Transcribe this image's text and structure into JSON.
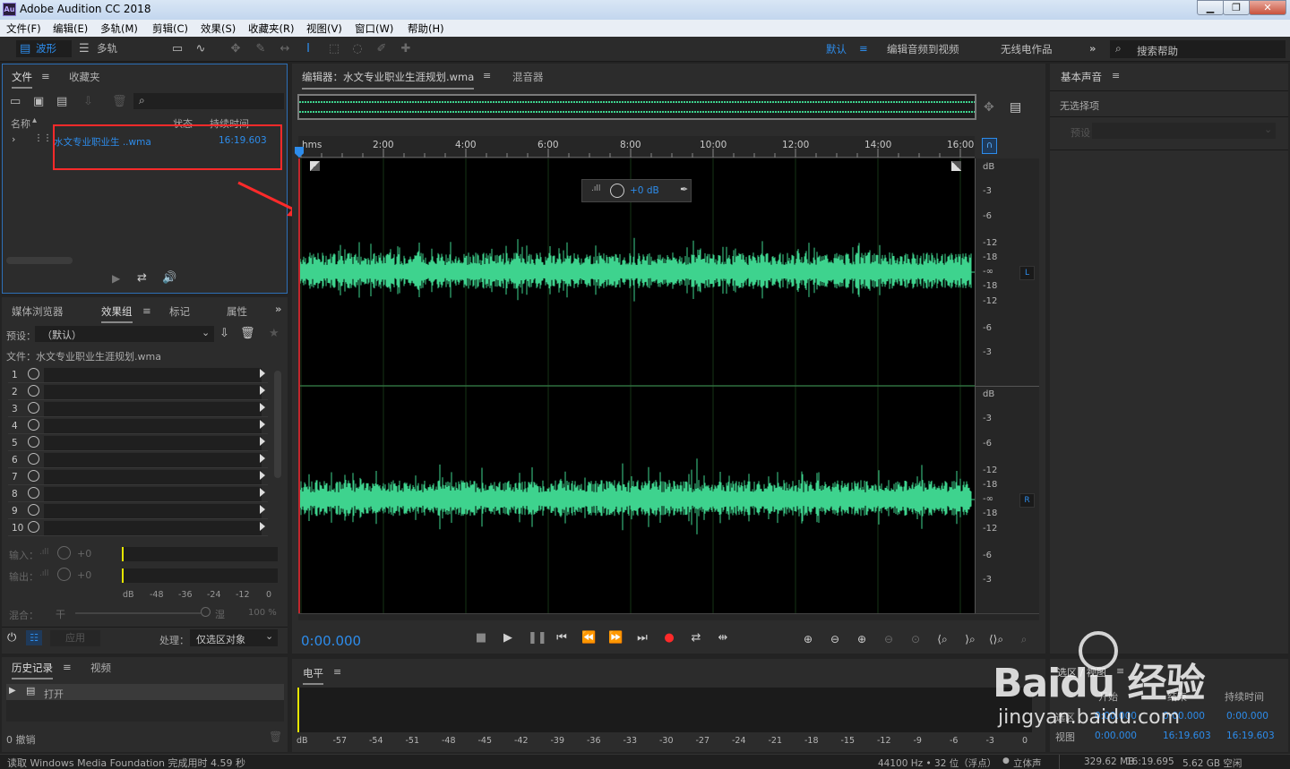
{
  "app": {
    "title": "Adobe Audition CC 2018",
    "logo": "Au"
  },
  "menu": [
    "文件(F)",
    "编辑(E)",
    "多轨(M)",
    "剪辑(C)",
    "效果(S)",
    "收藏夹(R)",
    "视图(V)",
    "窗口(W)",
    "帮助(H)"
  ],
  "toolbar": {
    "waveform": "波形",
    "multitrack": "多轨",
    "workspaces": [
      "默认",
      "编辑音频到视频",
      "无线电作品"
    ],
    "more": "»",
    "search_placeholder": "搜索帮助"
  },
  "files_panel": {
    "tabs": [
      "文件",
      "收藏夹"
    ],
    "columns": {
      "name": "名称",
      "status": "状态",
      "duration": "持续时间"
    },
    "file": {
      "name": "水文专业职业生 ..wma",
      "duration": "16:19.603"
    }
  },
  "effects_panel": {
    "tabs": [
      "媒体浏览器",
      "效果组",
      "标记",
      "属性"
    ],
    "preset_label": "预设：",
    "preset_value": "（默认）",
    "file_label": "文件：水文专业职业生涯规划.wma",
    "rows": [
      "1",
      "2",
      "3",
      "4",
      "5",
      "6",
      "7",
      "8",
      "9",
      "10"
    ],
    "input_label": "输入：",
    "output_label": "输出：",
    "gain_value": "+0",
    "meter_scale": [
      "dB",
      "-48",
      "-36",
      "-24",
      "-12",
      "0"
    ],
    "mix_label": "混合：",
    "mix_dry": "干",
    "mix_wet": "湿",
    "mix_value": "100 %",
    "apply_button": "应用",
    "process_label": "处理：",
    "process_value": "仅选区对象"
  },
  "history_panel": {
    "tabs": [
      "历史记录",
      "视频"
    ],
    "item": "打开",
    "undo_count": "0 撤销"
  },
  "editor": {
    "tab": "编辑器：水文专业职业生涯规划.wma",
    "mixer_tab": "混音器",
    "ruler": [
      "hms",
      "2:00",
      "4:00",
      "6:00",
      "8:00",
      "10:00",
      "12:00",
      "14:00",
      "16:00"
    ],
    "db_scale": [
      "dB",
      "-3",
      "-6",
      "-12",
      "-18",
      "-∞",
      "-18",
      "-12",
      "-6",
      "-3"
    ],
    "hud_gain": "+0 dB",
    "channel_left": "L",
    "channel_right": "R",
    "current_time": "0:00.000"
  },
  "level_panel": {
    "title": "电平",
    "scale": [
      "dB",
      "-57",
      "-54",
      "-51",
      "-48",
      "-45",
      "-42",
      "-39",
      "-36",
      "-33",
      "-30",
      "-27",
      "-24",
      "-21",
      "-18",
      "-15",
      "-12",
      "-9",
      "-6",
      "-3",
      "0"
    ]
  },
  "essential_sound": {
    "title": "基本声音",
    "no_selection": "无选择项",
    "preset_label": "预设："
  },
  "selection_panel": {
    "title": "选区 / 视图",
    "headers": [
      "开始",
      "结束",
      "持续时间"
    ],
    "selection_label": "选区",
    "view_label": "视图",
    "selection": [
      "0:00.000",
      "0:00.000",
      "0:00.000"
    ],
    "view": [
      "0:00.000",
      "16:19.603",
      "16:19.603"
    ]
  },
  "statusbar": {
    "message": "读取 Windows Media Foundation 完成用时 4.59 秒",
    "sample_rate": "44100 Hz • 32 位（浮点）",
    "channels": "立体声",
    "size": "329.62 MB",
    "duration": "16:19.695",
    "free": "5.62 GB 空闲"
  },
  "watermark": {
    "brand": "Baidu 经验",
    "url": "jingyan.baidu.com"
  },
  "colors": {
    "accent": "#2d8ceb",
    "waveform": "#3ed38e",
    "highlight": "#ff2a2a"
  }
}
